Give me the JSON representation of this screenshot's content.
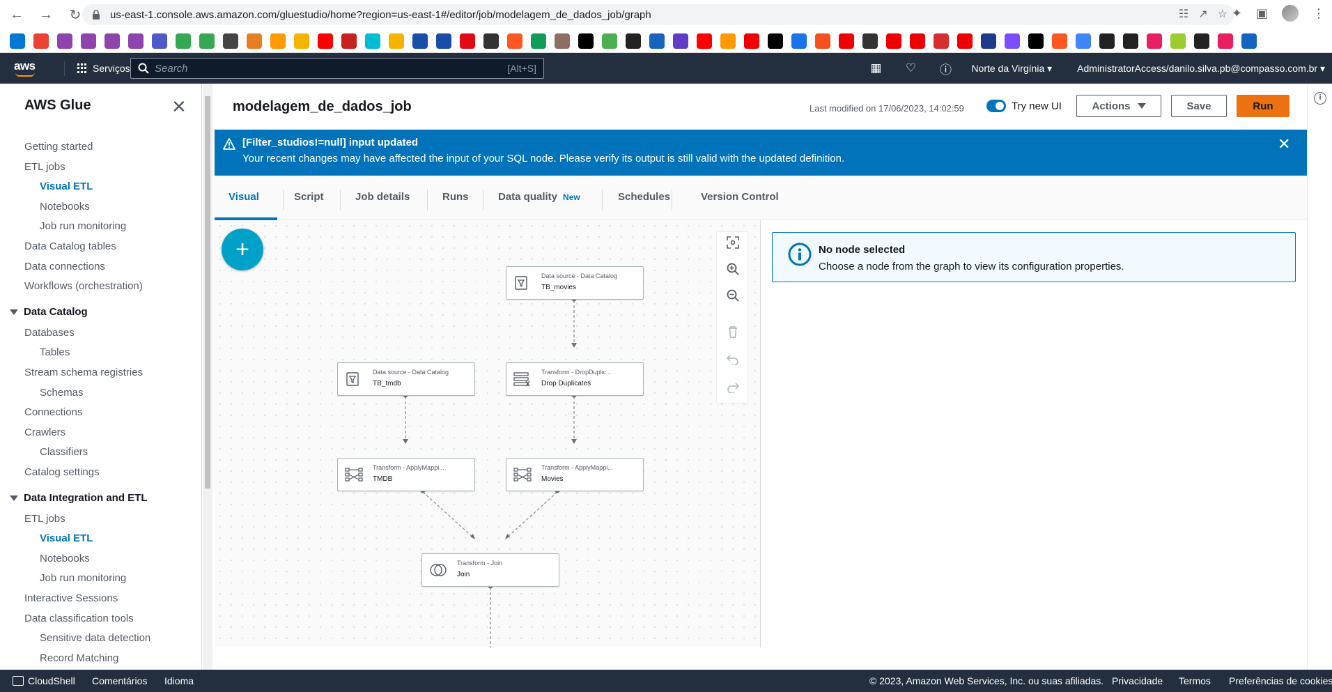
{
  "browser": {
    "url": "us-east-1.console.aws.amazon.com/gluestudio/home?region=us-east-1#/editor/job/modelagem_de_dados_job/graph",
    "bookmark_colors": [
      "#0078d4",
      "#ea4335",
      "#8e44ad",
      "#8e44ad",
      "#8e44ad",
      "#8e44ad",
      "#5059c9",
      "#34a853",
      "#34a853",
      "#444",
      "#e67e22",
      "#ff9900",
      "#f4b400",
      "#ff0000",
      "#c5221f",
      "#00bcd4",
      "#f4b400",
      "#174ea6",
      "#174ea6",
      "#e50914",
      "#333",
      "#ff5722",
      "#0f9d58",
      "#8d6e63",
      "#000",
      "#4caf50",
      "#222",
      "#1565c0",
      "#5f3dc4",
      "#ff0000",
      "#ff9900",
      "#e00",
      "#000",
      "#1a73e8",
      "#f4511e",
      "#e00",
      "#333",
      "#e00",
      "#e00",
      "#d32f2f",
      "#e00",
      "#1e3a8a",
      "#7c4dff",
      "#000",
      "#ff5722",
      "#4285f4",
      "#222",
      "#222",
      "#e91e63",
      "#9acd32",
      "#222",
      "#e91e63",
      "#1565c0"
    ]
  },
  "aws_header": {
    "logo": "aws",
    "services_label": "Serviços",
    "search_placeholder": "Search",
    "search_shortcut": "[Alt+S]",
    "region": "Norte da Virgínia",
    "account": "AdministratorAccess/danilo.silva.pb@compasso.com.br"
  },
  "sidenav": {
    "title": "AWS Glue",
    "items": [
      {
        "label": "Getting started",
        "level": 0
      },
      {
        "label": "ETL jobs",
        "level": 0
      },
      {
        "label": "Visual ETL",
        "level": 1,
        "active": true
      },
      {
        "label": "Notebooks",
        "level": 1
      },
      {
        "label": "Job run monitoring",
        "level": 1
      },
      {
        "label": "Data Catalog tables",
        "level": 0
      },
      {
        "label": "Data connections",
        "level": 0
      },
      {
        "label": "Workflows (orchestration)",
        "level": 0
      }
    ],
    "section_data_catalog": "Data Catalog",
    "catalog_items": [
      {
        "label": "Databases",
        "level": 0
      },
      {
        "label": "Tables",
        "level": 1
      },
      {
        "label": "Stream schema registries",
        "level": 0
      },
      {
        "label": "Schemas",
        "level": 1
      },
      {
        "label": "Connections",
        "level": 0
      },
      {
        "label": "Crawlers",
        "level": 0
      },
      {
        "label": "Classifiers",
        "level": 1
      },
      {
        "label": "Catalog settings",
        "level": 0
      }
    ],
    "section_integration": "Data Integration and ETL",
    "integration_items": [
      {
        "label": "ETL jobs",
        "level": 0
      },
      {
        "label": "Visual ETL",
        "level": 1,
        "active": true
      },
      {
        "label": "Notebooks",
        "level": 1
      },
      {
        "label": "Job run monitoring",
        "level": 1
      },
      {
        "label": "Interactive Sessions",
        "level": 0
      },
      {
        "label": "Data classification tools",
        "level": 0
      },
      {
        "label": "Sensitive data detection",
        "level": 1
      },
      {
        "label": "Record Matching",
        "level": 1
      }
    ]
  },
  "job": {
    "title": "modelagem_de_dados_job",
    "last_modified": "Last modified on 17/06/2023, 14:02:59",
    "try_new_ui": "Try new UI",
    "actions_label": "Actions",
    "save_label": "Save",
    "run_label": "Run"
  },
  "flash": {
    "title": "[Filter_studios!=null] input updated",
    "text": "Your recent changes may have affected the input of your SQL node. Please verify its output is still valid with the updated definition."
  },
  "tabs": [
    {
      "label": "Visual",
      "active": true
    },
    {
      "label": "Script"
    },
    {
      "label": "Job details"
    },
    {
      "label": "Runs"
    },
    {
      "label": "Data quality",
      "badge": "New"
    },
    {
      "label": "Schedules"
    },
    {
      "label": "Version Control"
    }
  ],
  "graph": {
    "nodes": [
      {
        "id": "tb_movies",
        "type": "Data source - Data Catalog",
        "name": "TB_movies",
        "icon": "catalog-icon"
      },
      {
        "id": "tb_tmdb",
        "type": "Data source - Data Catalog",
        "name": "TB_tmdb",
        "icon": "catalog-icon"
      },
      {
        "id": "drop_duplicates",
        "type": "Transform - DropDuplic...",
        "name": "Drop Duplicates",
        "icon": "drop-duplicates-icon"
      },
      {
        "id": "tmdb_map",
        "type": "Transform - ApplyMappi...",
        "name": "TMDB",
        "icon": "apply-mapping-icon"
      },
      {
        "id": "movies_map",
        "type": "Transform - ApplyMappi...",
        "name": "Movies",
        "icon": "apply-mapping-icon"
      },
      {
        "id": "join",
        "type": "Transform - Join",
        "name": "Join",
        "icon": "join-icon"
      }
    ]
  },
  "info_panel": {
    "title": "No node selected",
    "text": "Choose a node from the graph to view its configuration properties."
  },
  "footer": {
    "cloudshell": "CloudShell",
    "feedback": "Comentários",
    "language": "Idioma",
    "copyright": "© 2023, Amazon Web Services, Inc. ou suas afiliadas.",
    "privacy": "Privacidade",
    "terms": "Termos",
    "cookies": "Preferências de cookies"
  }
}
